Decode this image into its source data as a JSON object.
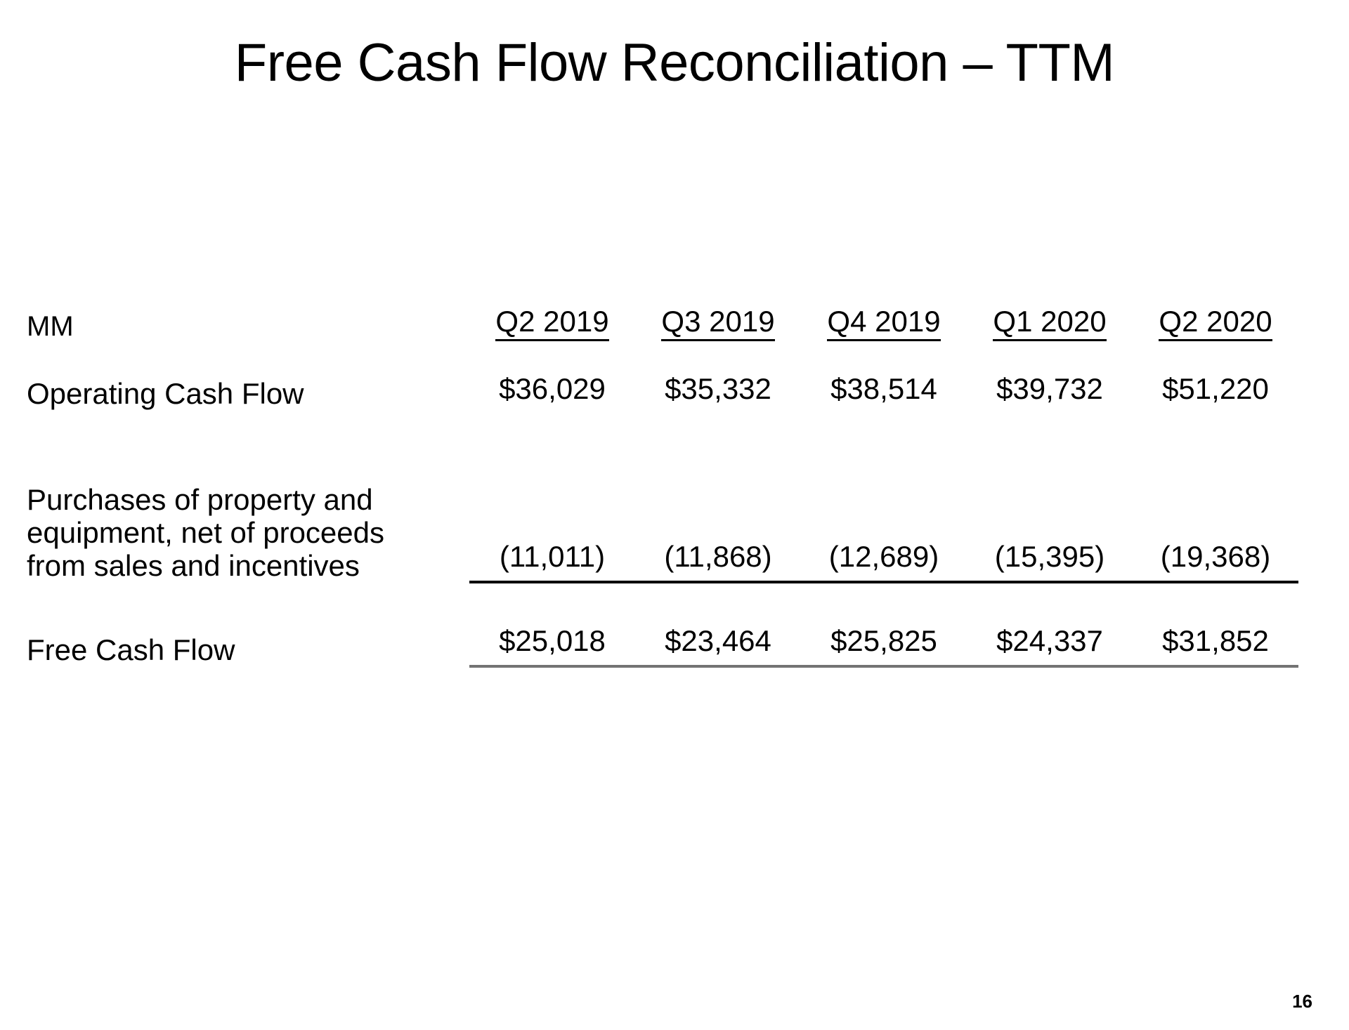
{
  "slide": {
    "title": "Free Cash Flow Reconciliation – TTM",
    "page_number": "16",
    "unit_label": "MM",
    "rule_color_subtotal": "#000000",
    "rule_color_total": "#737373",
    "text_color": "#000000",
    "background_color": "#FFFFFF"
  },
  "table": {
    "columns": [
      "Q2 2019",
      "Q3 2019",
      "Q4 2019",
      "Q1 2020",
      "Q2 2020"
    ],
    "rows": [
      {
        "label": "Operating Cash Flow",
        "label_lines": [
          "Operating Cash Flow"
        ],
        "values": [
          "$36,029",
          "$35,332",
          "$38,514",
          "$39,732",
          "$51,220"
        ],
        "rule": "none"
      },
      {
        "label": "Purchases of property and equipment, net of proceeds from sales and incentives",
        "label_lines": [
          "Purchases of property and",
          "equipment, net of proceeds",
          "from sales and incentives"
        ],
        "values": [
          "(11,011)",
          "(11,868)",
          "(12,689)",
          "(15,395)",
          "(19,368)"
        ],
        "rule": "black"
      },
      {
        "label": "Free Cash Flow",
        "label_lines": [
          "Free Cash Flow"
        ],
        "values": [
          "$25,018",
          "$23,464",
          "$25,825",
          "$24,337",
          "$31,852"
        ],
        "rule": "gray"
      }
    ]
  },
  "chart_data": {
    "type": "table",
    "title": "Free Cash Flow Reconciliation – TTM",
    "units": "MM",
    "categories": [
      "Q2 2019",
      "Q3 2019",
      "Q4 2019",
      "Q1 2020",
      "Q2 2020"
    ],
    "series": [
      {
        "name": "Operating Cash Flow",
        "values": [
          36029,
          35332,
          38514,
          39732,
          51220
        ],
        "display": [
          "$36,029",
          "$35,332",
          "$38,514",
          "$39,732",
          "$51,220"
        ]
      },
      {
        "name": "Purchases of property and equipment, net of proceeds from sales and incentives",
        "values": [
          -11011,
          -11868,
          -12689,
          -15395,
          -19368
        ],
        "display": [
          "(11,011)",
          "(11,868)",
          "(12,689)",
          "(15,395)",
          "(19,368)"
        ]
      },
      {
        "name": "Free Cash Flow",
        "values": [
          25018,
          23464,
          25825,
          24337,
          31852
        ],
        "display": [
          "$25,018",
          "$23,464",
          "$25,825",
          "$24,337",
          "$31,852"
        ]
      }
    ]
  }
}
